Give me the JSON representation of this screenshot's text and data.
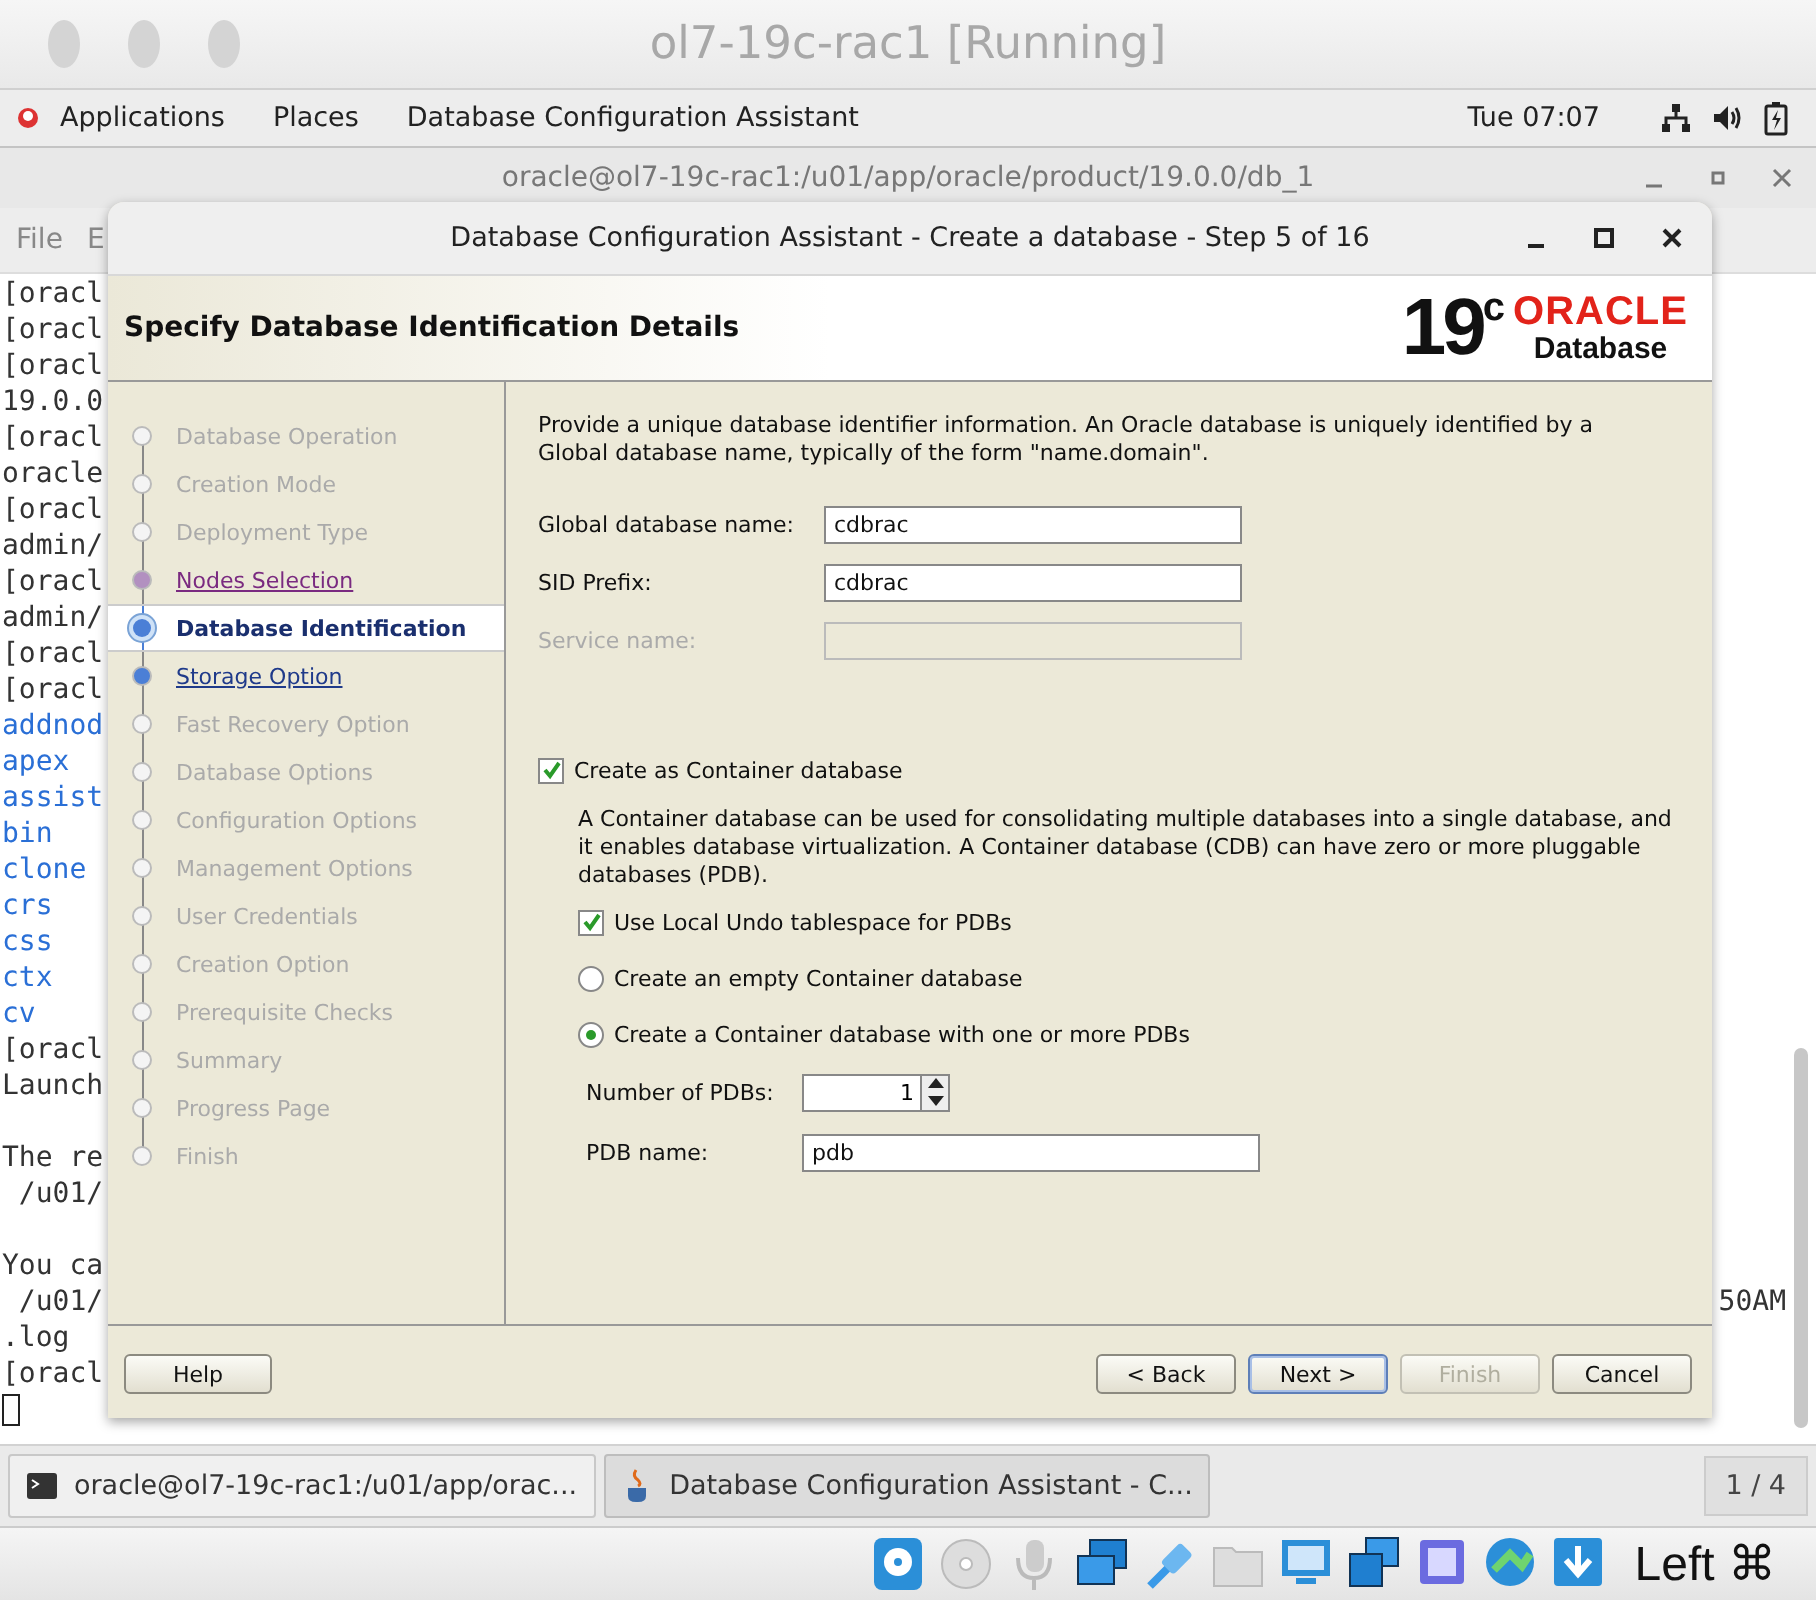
{
  "host_window": {
    "title": "ol7-19c-rac1 [Running]"
  },
  "top_bar": {
    "menus": [
      "Applications",
      "Places",
      "Database Configuration Assistant"
    ],
    "clock": "Tue 07:07"
  },
  "terminal": {
    "title": "oracle@ol7-19c-rac1:/u01/app/oracle/product/19.0.0/db_1",
    "menus": [
      "File",
      "E"
    ],
    "lines": [
      {
        "kind": "plain",
        "text": "[oracl"
      },
      {
        "kind": "plain",
        "text": "[oracl"
      },
      {
        "kind": "plain",
        "text": "[oracl"
      },
      {
        "kind": "plain",
        "text": "19.0.0"
      },
      {
        "kind": "plain",
        "text": "[oracl"
      },
      {
        "kind": "plain",
        "text": "oracle"
      },
      {
        "kind": "plain",
        "text": "[oracl"
      },
      {
        "kind": "plain",
        "text": "admin/"
      },
      {
        "kind": "plain",
        "text": "[oracl"
      },
      {
        "kind": "plain",
        "text": "admin/"
      },
      {
        "kind": "plain",
        "text": "[oracl"
      },
      {
        "kind": "plain",
        "text": "[oracl"
      },
      {
        "kind": "dir",
        "text": "addnod"
      },
      {
        "kind": "dir",
        "text": "apex"
      },
      {
        "kind": "dir",
        "text": "assist"
      },
      {
        "kind": "dir",
        "text": "bin"
      },
      {
        "kind": "dir",
        "text": "clone"
      },
      {
        "kind": "dir",
        "text": "crs"
      },
      {
        "kind": "dir",
        "text": "css"
      },
      {
        "kind": "dir",
        "text": "ctx"
      },
      {
        "kind": "dir",
        "text": "cv"
      },
      {
        "kind": "plain",
        "text": "[oracl"
      },
      {
        "kind": "plain",
        "text": "Launch"
      },
      {
        "kind": "blank"
      },
      {
        "kind": "plain",
        "text": "The re"
      },
      {
        "kind": "plain",
        "text": " /u01/"
      },
      {
        "kind": "blank"
      },
      {
        "kind": "plain",
        "text": "You ca"
      },
      {
        "kind": "plain",
        "text": " /u01/",
        "right": "50AM"
      },
      {
        "kind": "plain",
        "text": ".log"
      },
      {
        "kind": "plain",
        "text": "[oracl"
      },
      {
        "kind": "cursor"
      }
    ]
  },
  "dialog": {
    "title": "Database Configuration Assistant - Create a database - Step 5 of 16",
    "heading": "Specify Database Identification Details",
    "logo": {
      "version": "19",
      "suffix": "c",
      "brand": "ORACLE",
      "product": "Database"
    },
    "steps": [
      {
        "label": "Database Operation",
        "kind": "disabled",
        "selected": false
      },
      {
        "label": "Creation Mode",
        "kind": "disabled",
        "selected": false
      },
      {
        "label": "Deployment Type",
        "kind": "disabled",
        "selected": false
      },
      {
        "label": "Nodes Selection",
        "kind": "visited",
        "selected": false
      },
      {
        "label": "Database Identification",
        "kind": "link",
        "selected": true
      },
      {
        "label": "Storage Option",
        "kind": "link",
        "selected": false
      },
      {
        "label": "Fast Recovery Option",
        "kind": "disabled",
        "selected": false
      },
      {
        "label": "Database Options",
        "kind": "disabled",
        "selected": false
      },
      {
        "label": "Configuration Options",
        "kind": "disabled",
        "selected": false
      },
      {
        "label": "Management Options",
        "kind": "disabled",
        "selected": false
      },
      {
        "label": "User Credentials",
        "kind": "disabled",
        "selected": false
      },
      {
        "label": "Creation Option",
        "kind": "disabled",
        "selected": false
      },
      {
        "label": "Prerequisite Checks",
        "kind": "disabled",
        "selected": false
      },
      {
        "label": "Summary",
        "kind": "disabled",
        "selected": false
      },
      {
        "label": "Progress Page",
        "kind": "disabled",
        "selected": false
      },
      {
        "label": "Finish",
        "kind": "disabled",
        "selected": false
      }
    ],
    "intro": "Provide a unique database identifier information. An Oracle database is uniquely identified by a Global database name, typically of the form \"name.domain\".",
    "fields": [
      {
        "label": "Global database name:",
        "value": "cdbrac",
        "disabled": false
      },
      {
        "label": "SID Prefix:",
        "value": "cdbrac",
        "disabled": false
      },
      {
        "label": "Service name:",
        "disabled": true
      }
    ],
    "container": {
      "label": "Create as Container database",
      "checked": true,
      "description": "A Container database can be used for consolidating multiple databases into a single database, and it enables database virtualization. A Container database (CDB) can have zero or more pluggable databases (PDB).",
      "local_undo": {
        "label": "Use Local Undo tablespace for PDBs",
        "checked": true
      },
      "choices": [
        {
          "label": "Create an empty Container database",
          "selected": false
        },
        {
          "label": "Create a Container database with one or more PDBs",
          "selected": true
        }
      ],
      "pdb_count": {
        "label": "Number of PDBs:",
        "value": "1"
      },
      "pdb_name": {
        "label": "PDB name:",
        "value": "pdb"
      }
    },
    "help_button": {
      "label": "Help"
    },
    "buttons": [
      {
        "label": "< Back",
        "disabled": false,
        "default": false
      },
      {
        "label": "Next >",
        "disabled": false,
        "default": true
      },
      {
        "label": "Finish",
        "disabled": true,
        "default": false
      },
      {
        "label": "Cancel",
        "disabled": false,
        "default": false
      }
    ]
  },
  "taskbar": {
    "tasks": [
      {
        "label": "oracle@ol7-19c-rac1:/u01/app/orac...",
        "kind": "terminal",
        "selected": false
      },
      {
        "label": "Database Configuration Assistant - C...",
        "kind": "java",
        "selected": true
      }
    ],
    "workspace": "1 / 4"
  },
  "status_bar": {
    "host_key": "Left ⌘"
  }
}
